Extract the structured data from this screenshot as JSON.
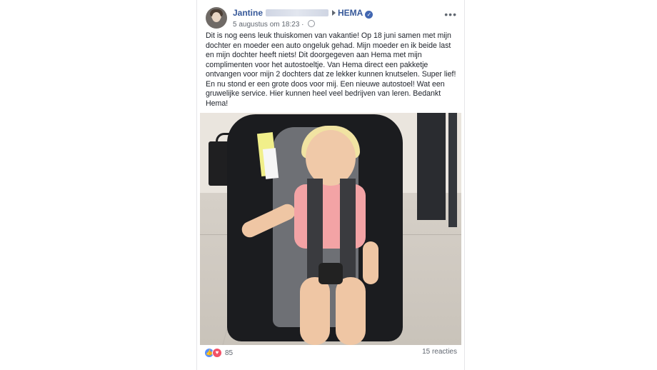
{
  "post": {
    "author": "Jantine",
    "page_name": "HEMA",
    "timestamp": "5 augustus om 18:23",
    "more_icon": "more-horizontal-icon",
    "verified_icon": "verified-check-icon",
    "privacy_icon": "globe-icon",
    "text": "Dit is nog eens leuk thuiskomen van vakantie! Op 18 juni samen met mijn dochter en moeder een auto ongeluk gehad. Mijn moeder en ik beide last en mijn dochter heeft niets! Dit doorgegeven aan Hema met mijn complimenten voor het autostoeltje. Van Hema direct een pakketje ontvangen voor mijn 2 dochters dat ze lekker kunnen knutselen. Super lief! En nu stond er een grote doos voor mij. Een nieuwe autostoel! Wat een gruwelijke service. Hier kunnen heel veel bedrijven van leren. Bedankt Hema!"
  },
  "footer": {
    "reactions_count": "85",
    "comments_label": "15 reacties"
  },
  "colors": {
    "link": "#365899",
    "like": "#5890ff",
    "love": "#f25268"
  }
}
